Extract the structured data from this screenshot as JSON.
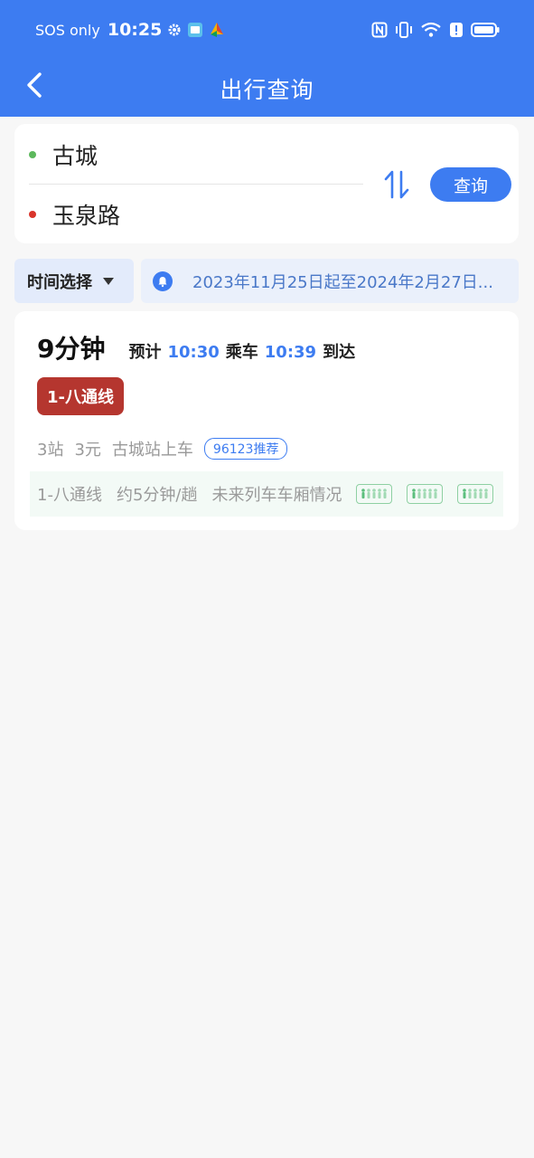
{
  "status_bar": {
    "carrier": "SOS only",
    "time": "10:25",
    "icons": [
      "gear-icon",
      "app-icon",
      "app-icon-2",
      "nfc-icon",
      "vibrate-icon",
      "wifi-icon",
      "alert-icon",
      "battery-icon"
    ]
  },
  "nav": {
    "title": "出行查询"
  },
  "route": {
    "from": "古城",
    "to": "玉泉路",
    "query_label": "查询",
    "from_color": "#5cb85c",
    "to_color": "#d9342b"
  },
  "filter": {
    "time_select_label": "时间选择",
    "notice_text": "2023年11月25日起至2024年2月27日..."
  },
  "trip": {
    "duration": "9分钟",
    "depart_prefix": "预计",
    "depart_time": "10:30",
    "depart_suffix": "乘车",
    "arrive_time": "10:39",
    "arrive_suffix": "到达",
    "line_name": "1-八通线",
    "line_color": "#b5362f",
    "stations": "3站",
    "price": "3元",
    "board": "古城站上车",
    "tag": "96123推荐",
    "train_line": "1-八通线",
    "frequency": "约5分钟/趟",
    "crowd_label": "未来列车车厢情况"
  },
  "colors": {
    "primary": "#3d7cf1",
    "crowd_green": "#8ed0a2"
  }
}
